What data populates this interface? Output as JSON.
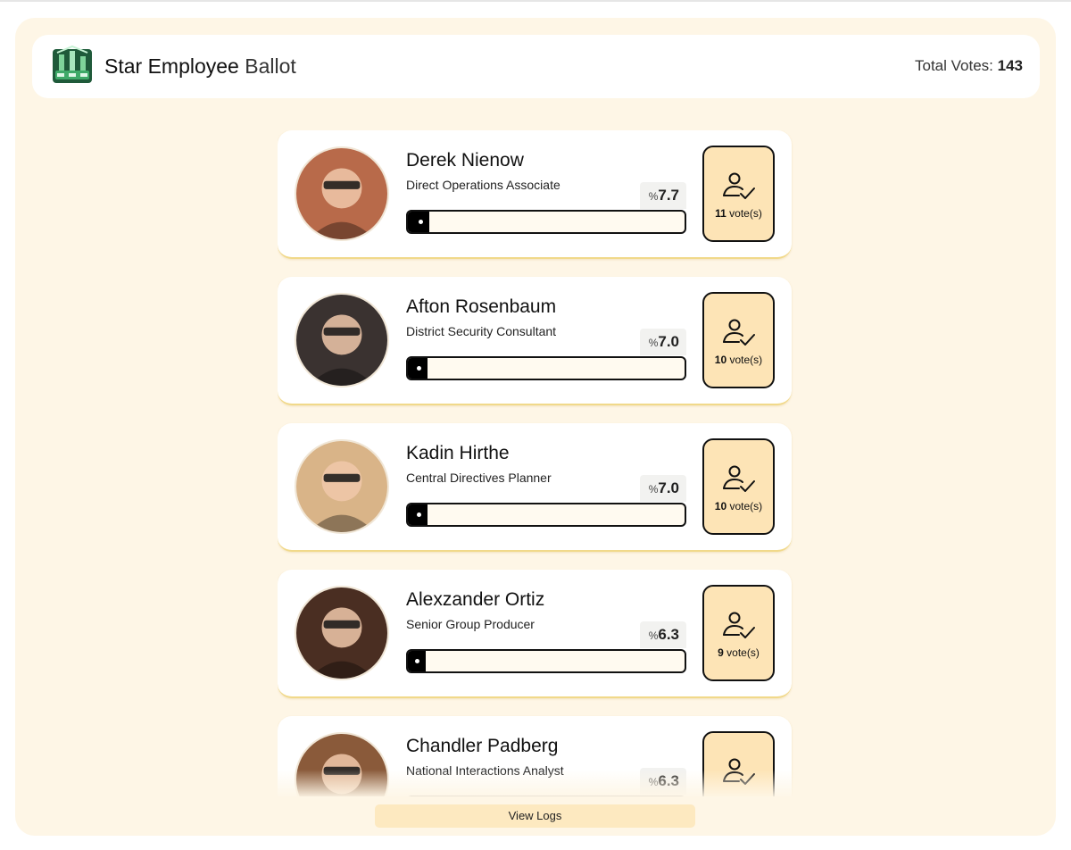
{
  "header": {
    "title_bold": "Star Employee",
    "title_light": "Ballot",
    "total_label": "Total Votes:",
    "total_value": "143",
    "logo_icon": "ballot-logo-icon"
  },
  "candidates": [
    {
      "name": "Derek Nienow",
      "role": "Direct Operations Associate",
      "percent_symbol": "%",
      "percent": "7.7",
      "share": 0.077,
      "votes": "11",
      "votes_suffix": "vote(s)",
      "avatar_color": "#b86a4a"
    },
    {
      "name": "Afton Rosenbaum",
      "role": "District Security Consultant",
      "percent_symbol": "%",
      "percent": "7.0",
      "share": 0.07,
      "votes": "10",
      "votes_suffix": "vote(s)",
      "avatar_color": "#3a3230"
    },
    {
      "name": "Kadin Hirthe",
      "role": "Central Directives Planner",
      "percent_symbol": "%",
      "percent": "7.0",
      "share": 0.07,
      "votes": "10",
      "votes_suffix": "vote(s)",
      "avatar_color": "#d9b488"
    },
    {
      "name": "Alexzander Ortiz",
      "role": "Senior Group Producer",
      "percent_symbol": "%",
      "percent": "6.3",
      "share": 0.063,
      "votes": "9",
      "votes_suffix": "vote(s)",
      "avatar_color": "#4a2e22"
    },
    {
      "name": "Chandler Padberg",
      "role": "National Interactions Analyst",
      "percent_symbol": "%",
      "percent": "6.3",
      "share": 0.063,
      "votes": "",
      "votes_suffix": "",
      "avatar_color": "#8a5a3a"
    }
  ],
  "footer": {
    "view_logs_label": "View Logs"
  },
  "colors": {
    "app_bg": "#fef6e6",
    "card_border": "#f1d98a",
    "vote_button_bg": "#fde4b6",
    "logs_button_bg": "#fde9c0",
    "bar_fill": "#000000"
  },
  "icons": {
    "vote_icon": "user-check-icon"
  }
}
